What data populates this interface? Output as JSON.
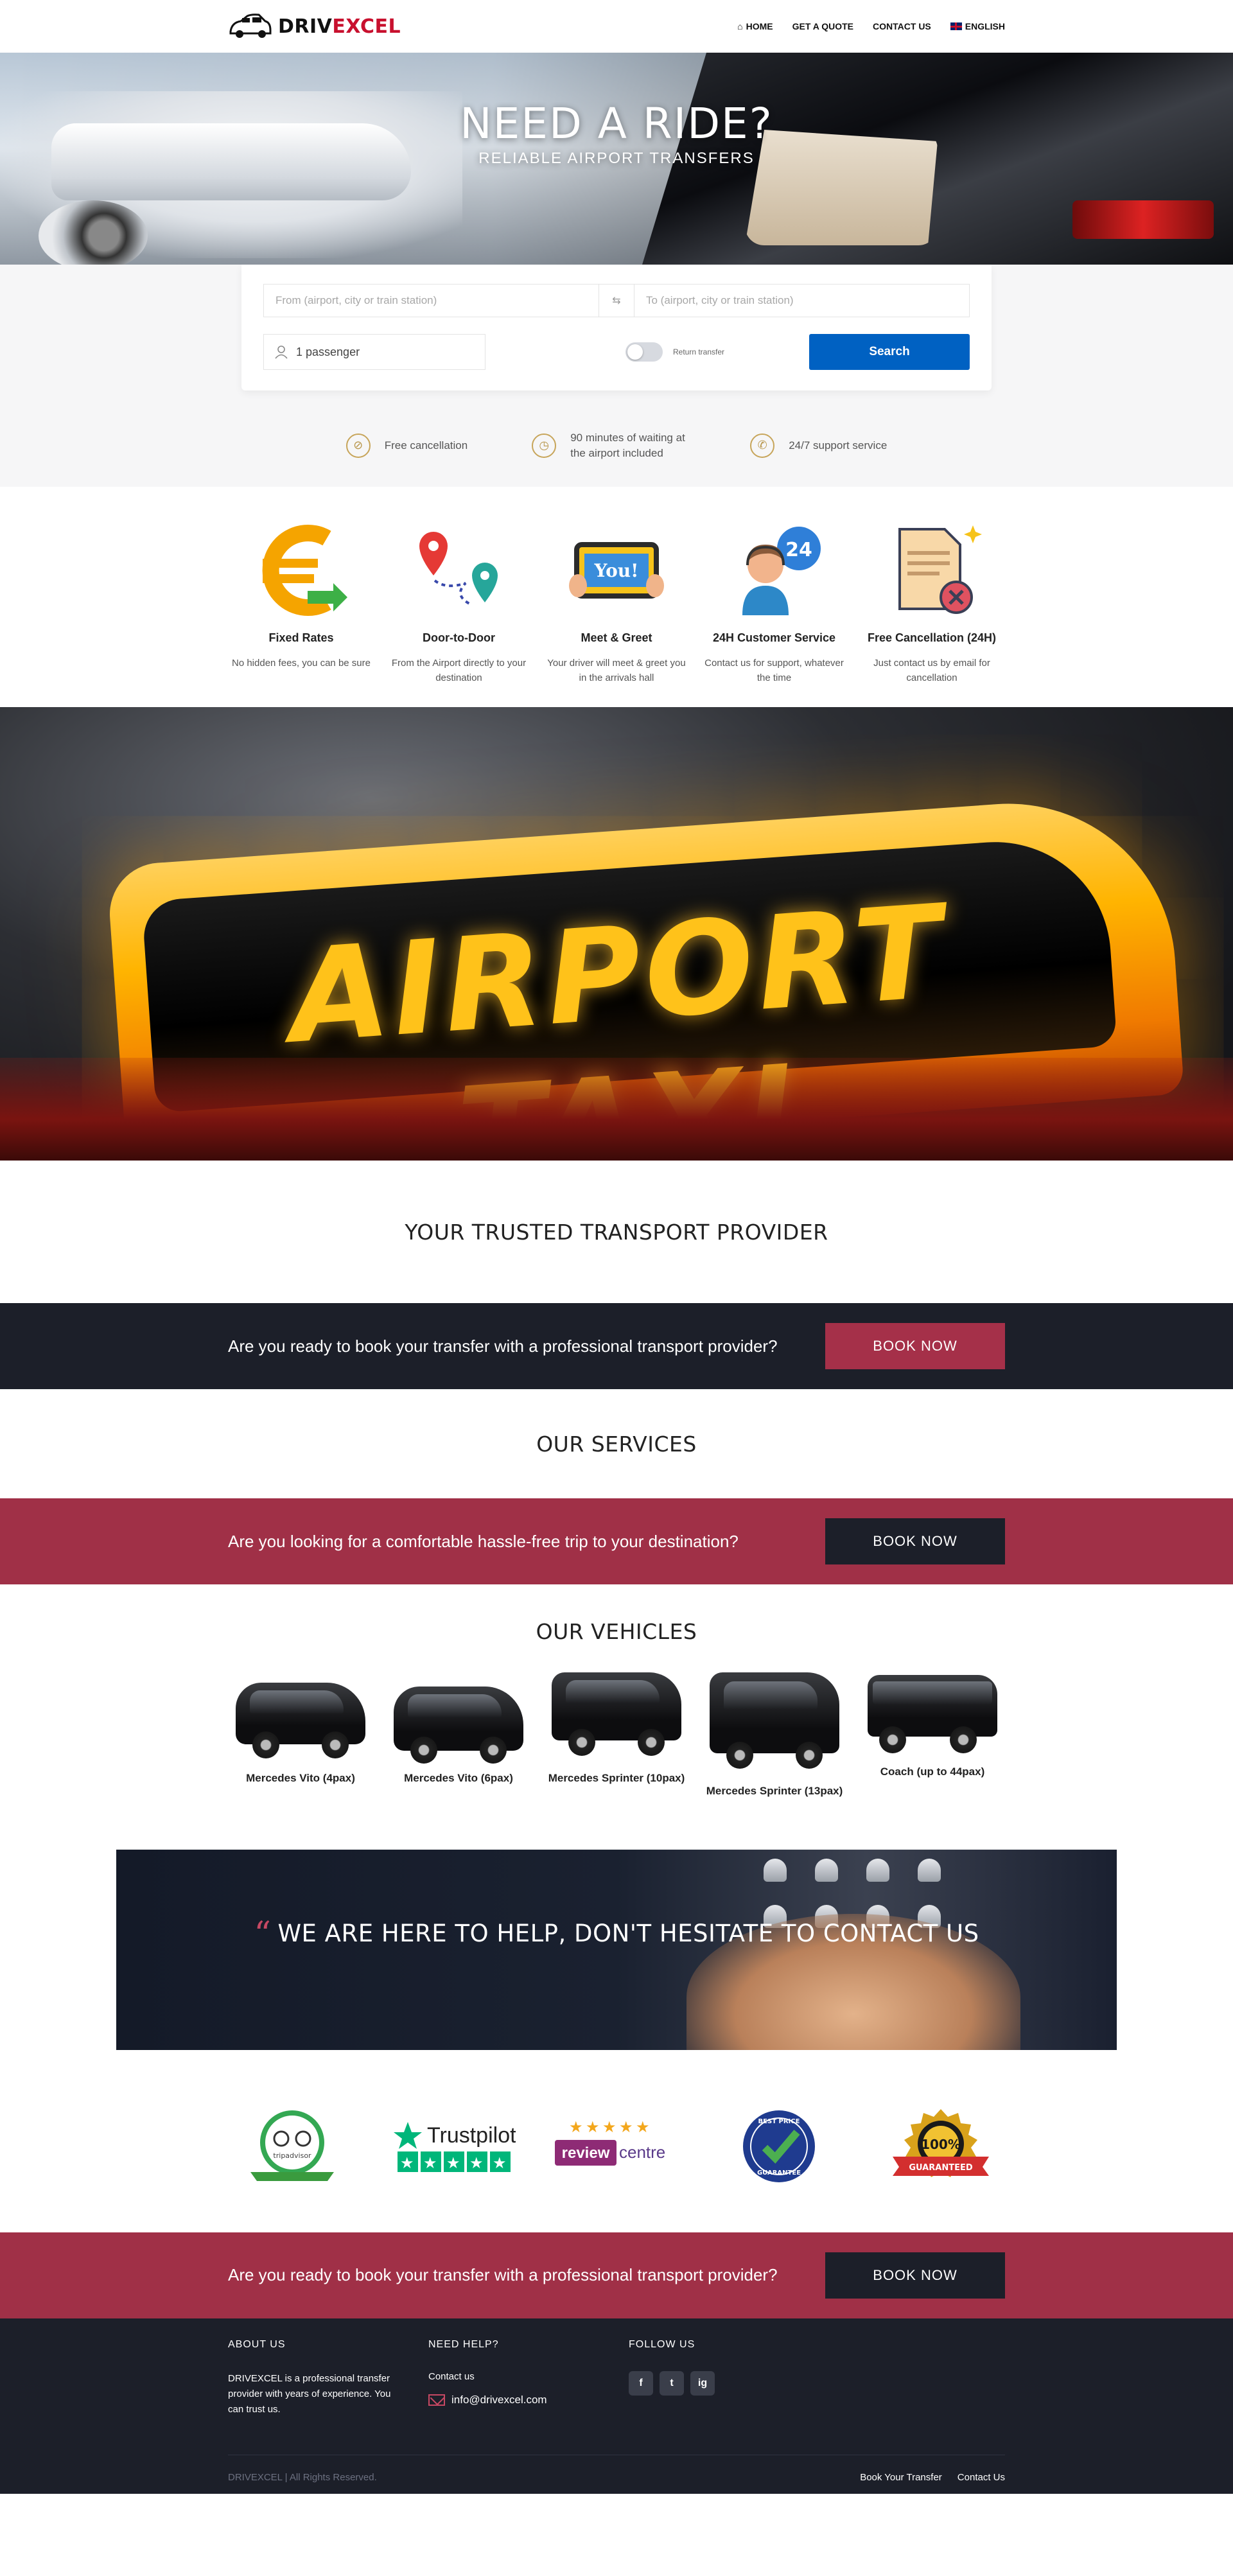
{
  "brand": {
    "name_part1": "DRIV",
    "name_part2": "EXCEL",
    "name_part3": ""
  },
  "nav": [
    {
      "label": "HOME",
      "icon": "home-icon"
    },
    {
      "label": "GET A QUOTE"
    },
    {
      "label": "CONTACT US"
    },
    {
      "label": "ENGLISH",
      "icon": "uk-flag-icon"
    }
  ],
  "hero": {
    "title": "NEED A RIDE?",
    "subtitle": "RELIABLE AIRPORT TRANSFERS"
  },
  "search": {
    "from_placeholder": "From (airport, city or train station)",
    "to_placeholder": "To (airport, city or train station)",
    "passengers": "1 passenger",
    "return_label": "Return transfer",
    "button": "Search"
  },
  "features": [
    {
      "icon": "cancel-icon",
      "text": "Free cancellation"
    },
    {
      "icon": "clock-icon",
      "text": "90 minutes of waiting at the airport included"
    },
    {
      "icon": "phone-icon",
      "text": "24/7 support service"
    }
  ],
  "benefits": [
    {
      "title": "Fixed Rates",
      "text": "No hidden fees, you can be sure",
      "icon": "euro-icon"
    },
    {
      "title": "Door-to-Door",
      "text": "From the Airport directly to your destination",
      "icon": "map-route-icon"
    },
    {
      "title": "Meet & Greet",
      "text": "Your driver will meet & greet you in the arrivals hall",
      "icon": "welcome-sign-icon",
      "sign_text": "You!"
    },
    {
      "title": "24H Customer Service",
      "text": "Contact us for support, whatever the time",
      "icon": "support-agent-icon",
      "badge": "24"
    },
    {
      "title": "Free Cancellation (24H)",
      "text": "Just contact us by email for cancellation",
      "icon": "cancel-document-icon"
    }
  ],
  "taxi_banner": {
    "sign_text": "AIRPORT TAXI"
  },
  "trusted": {
    "title": "YOUR TRUSTED TRANSPORT PROVIDER"
  },
  "cta1": {
    "text": "Are you ready to book your transfer with a professional transport provider?",
    "button": "BOOK NOW"
  },
  "services": {
    "title": "OUR SERVICES"
  },
  "cta2": {
    "text": "Are you looking for a comfortable hassle-free trip to your destination?",
    "button": "BOOK NOW"
  },
  "vehicles": {
    "title": "OUR VEHICLES",
    "items": [
      {
        "name": "Mercedes Vito (4pax)"
      },
      {
        "name": "Mercedes Vito (6pax)"
      },
      {
        "name": "Mercedes Sprinter (10pax)"
      },
      {
        "name": "Mercedes Sprinter (13pax)"
      },
      {
        "name": "Coach (up to 44pax)"
      }
    ]
  },
  "help": {
    "quote_mark": "“",
    "text": "WE ARE HERE TO HELP, DON'T HESITATE TO CONTACT US"
  },
  "badges": [
    {
      "name": "tripadvisor",
      "label": "tripadvisor"
    },
    {
      "name": "trustpilot",
      "label": "Trustpilot"
    },
    {
      "name": "review-centre",
      "label_a": "review",
      "label_b": "centre"
    },
    {
      "name": "best-price",
      "label_a": "BEST PRICE",
      "label_b": "GUARANTEE"
    },
    {
      "name": "satisfaction",
      "label": "100%",
      "label_b": "GUARANTEED"
    }
  ],
  "cta3": {
    "text": "Are you ready to book your transfer with a professional transport provider?",
    "button": "BOOK NOW"
  },
  "footer": {
    "about_title": "ABOUT US",
    "about_text": "DRIVEXCEL is a professional transfer provider with years of experience. You can trust us.",
    "help_title": "NEED HELP?",
    "contact_link": "Contact us",
    "email": "info@drivexcel.com",
    "follow_title": "FOLLOW US",
    "socials": [
      {
        "label": "f",
        "icon": "facebook-icon"
      },
      {
        "label": "t",
        "icon": "twitter-icon"
      },
      {
        "label": "ig",
        "icon": "instagram-icon"
      }
    ],
    "copyright": "DRIVEXCEL | All Rights Reserved.",
    "bottom_links": [
      "Book Your Transfer",
      "Contact Us"
    ]
  },
  "colors": {
    "primary_blue": "#0061c2",
    "accent_red": "#a53049",
    "dark": "#1c1f29"
  }
}
